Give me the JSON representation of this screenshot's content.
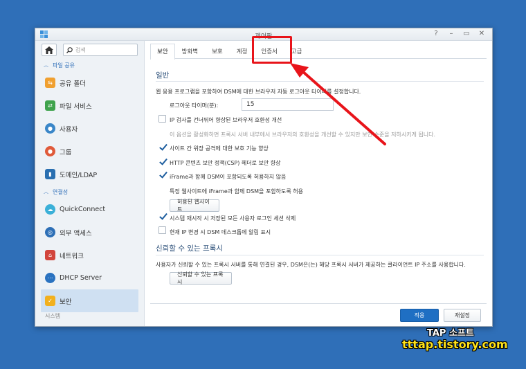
{
  "window": {
    "title": "제어판",
    "controls": {
      "help": "?",
      "minimize": "–",
      "maximize": "▭",
      "close": "✕"
    }
  },
  "sidebar": {
    "search_placeholder": "검색",
    "sections": [
      {
        "label": "파일 공유",
        "items": [
          {
            "label": "공유 폴더",
            "icon": "share-folder-icon",
            "color": "#f0a030"
          },
          {
            "label": "파일 서비스",
            "icon": "file-service-icon",
            "color": "#3fa34d"
          },
          {
            "label": "사용자",
            "icon": "user-icon",
            "color": "#3a86c8"
          },
          {
            "label": "그룹",
            "icon": "group-icon",
            "color": "#e05a3a"
          },
          {
            "label": "도메인/LDAP",
            "icon": "domain-icon",
            "color": "#2a6fb0"
          }
        ]
      },
      {
        "label": "연결성",
        "items": [
          {
            "label": "QuickConnect",
            "icon": "quickconnect-icon",
            "color": "#3bb0d8"
          },
          {
            "label": "외부 액세스",
            "icon": "external-access-icon",
            "color": "#2d6fb6"
          },
          {
            "label": "네트워크",
            "icon": "network-icon",
            "color": "#d2453c"
          },
          {
            "label": "DHCP Server",
            "icon": "dhcp-icon",
            "color": "#2a72c0"
          },
          {
            "label": "보안",
            "icon": "security-shield-icon",
            "color": "#f2b01e"
          }
        ]
      }
    ],
    "partial_label": "시스템"
  },
  "tabs": [
    "보안",
    "방화벽",
    "보호",
    "계정",
    "인증서",
    "고급"
  ],
  "general": {
    "title": "일반",
    "description": "웹 응용 프로그램을 포함하여 DSM에 대한 브라우저 자동 로그아웃 타이머를 설정합니다.",
    "logout_label": "로그아웃 타이머(분):",
    "logout_value": "15",
    "ip_check_label": "IP 검사를 건너뛰어 향상된 브라우저 호환성 개선",
    "ip_check_hint": "이 옵션을 활성화하면 프록시 서버 내부에서 브라우저의 호환성을 개선할 수 있지만 보안 수준을 저하시키게 됩니다.",
    "xss_label": "사이트 간 위장 공격에 대한 보호 기능 향상",
    "csp_label": "HTTP 콘텐츠 보안 정책(CSP) 헤더로 보안 향상",
    "iframe_label": "iFrame과 함께 DSM이 포함되도록 허용하지 않음",
    "iframe_sub": "특정 웹사이트에 iFrame과 함께 DSM을 포함하도록 허용",
    "allowed_sites_button": "허용된 웹사이트",
    "session_label": "시스템 재시작 시 저장된 모든 사용자 로그인 세션 삭제",
    "ip_change_label": "현재 IP 변경 시 DSM 데스크톱에 알림 표시"
  },
  "proxy": {
    "title": "신뢰할 수 있는 프록시",
    "description": "사용자가 신뢰할 수 있는 프록시 서버를 통해 연결된 경우, DSM은(는) 해당 프록시 서버가 제공하는 클라이언트 IP 주소를 사용합니다.",
    "button": "신뢰할 수 있는 프록시"
  },
  "footer": {
    "apply": "적용",
    "reset": "재설정"
  },
  "watermark": {
    "line1": "TAP 소프트",
    "line2": "tttap.tistory.com"
  },
  "colors": {
    "accent": "#1f6fc3",
    "highlight": "#e8141a"
  }
}
